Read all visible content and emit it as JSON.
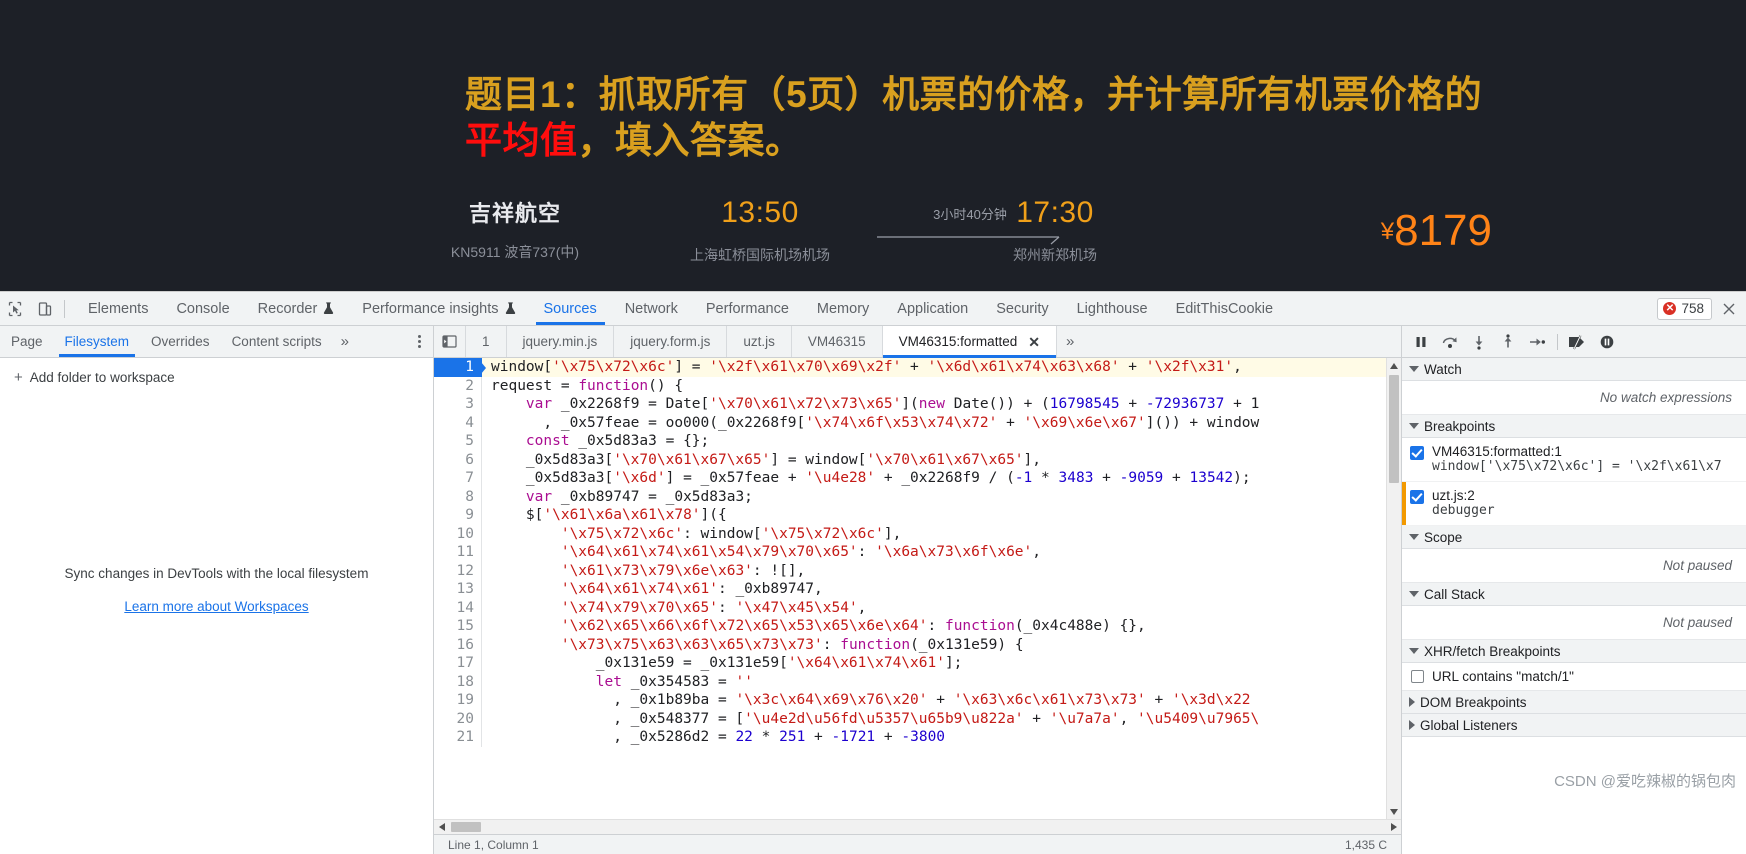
{
  "page": {
    "headline_part1": "题目1：抓取所有（5页）机票的价格，并计算所有机票价格的",
    "headline_highlight": "平均值",
    "headline_part2": "，填入答案。",
    "flight": {
      "airline": "吉祥航空",
      "aircraft": "KN5911 波音737(中)",
      "depart_time": "13:50",
      "depart_airport": "上海虹桥国际机场机场",
      "duration": "3小时40分钟",
      "arrive_time": "17:30",
      "arrive_airport": "郑州新郑机场",
      "price_currency": "¥",
      "price_amount": "8179"
    }
  },
  "devtools": {
    "inspect_icon": "inspect-cursor-icon",
    "device_icon": "device-toolbar-icon",
    "tabs": [
      {
        "label": "Elements",
        "flask": false,
        "active": false
      },
      {
        "label": "Console",
        "flask": false,
        "active": false
      },
      {
        "label": "Recorder",
        "flask": true,
        "active": false
      },
      {
        "label": "Performance insights",
        "flask": true,
        "active": false
      },
      {
        "label": "Sources",
        "flask": false,
        "active": true
      },
      {
        "label": "Network",
        "flask": false,
        "active": false
      },
      {
        "label": "Performance",
        "flask": false,
        "active": false
      },
      {
        "label": "Memory",
        "flask": false,
        "active": false
      },
      {
        "label": "Application",
        "flask": false,
        "active": false
      },
      {
        "label": "Security",
        "flask": false,
        "active": false
      },
      {
        "label": "Lighthouse",
        "flask": false,
        "active": false
      },
      {
        "label": "EditThisCookie",
        "flask": false,
        "active": false
      }
    ],
    "error_badge": {
      "icon": "error-circle-icon",
      "count": "758"
    },
    "close_icon": "close-devtools-icon",
    "accent_color": "#1a73e8",
    "error_color": "#d93025"
  },
  "navigator": {
    "subtabs": [
      {
        "label": "Page",
        "active": false
      },
      {
        "label": "Filesystem",
        "active": true
      },
      {
        "label": "Overrides",
        "active": false
      },
      {
        "label": "Content scripts",
        "active": false
      }
    ],
    "more_label": "»",
    "add_folder_label": "Add folder to workspace",
    "add_folder_plus": "+",
    "empty_hint": "Sync changes in DevTools with the local filesystem",
    "empty_link": "Learn more about Workspaces"
  },
  "editor": {
    "collapse_icon": "collapse-sidebar-icon",
    "file_tabs": [
      {
        "label": "1",
        "active": false,
        "closable": false
      },
      {
        "label": "jquery.min.js",
        "active": false,
        "closable": false
      },
      {
        "label": "jquery.form.js",
        "active": false,
        "closable": false
      },
      {
        "label": "uzt.js",
        "active": false,
        "closable": false
      },
      {
        "label": "VM46315",
        "active": false,
        "closable": false
      },
      {
        "label": "VM46315:formatted",
        "active": true,
        "closable": true
      }
    ],
    "tab_close_glyph": "✕",
    "more_tabs_label": "»",
    "highlight_line": 1,
    "code_lines": [
      {
        "n": "1",
        "tokens": [
          {
            "t": "window[",
            "c": "pl"
          },
          {
            "t": "'\\x75\\x72\\x6c'",
            "c": "str"
          },
          {
            "t": "] = ",
            "c": "pl"
          },
          {
            "t": "'\\x2f\\x61\\x70\\x69\\x2f'",
            "c": "str"
          },
          {
            "t": " + ",
            "c": "pl"
          },
          {
            "t": "'\\x6d\\x61\\x74\\x63\\x68'",
            "c": "str"
          },
          {
            "t": " + ",
            "c": "pl"
          },
          {
            "t": "'\\x2f\\x31'",
            "c": "str"
          },
          {
            "t": ",",
            "c": "pl"
          }
        ]
      },
      {
        "n": "2",
        "tokens": [
          {
            "t": "request = ",
            "c": "pl"
          },
          {
            "t": "function",
            "c": "kw"
          },
          {
            "t": "() {",
            "c": "pl"
          }
        ]
      },
      {
        "n": "3",
        "tokens": [
          {
            "t": "    ",
            "c": "pl"
          },
          {
            "t": "var",
            "c": "kw"
          },
          {
            "t": " _0x2268f9 = Date[",
            "c": "pl"
          },
          {
            "t": "'\\x70\\x61\\x72\\x73\\x65'",
            "c": "str"
          },
          {
            "t": "](",
            "c": "pl"
          },
          {
            "t": "new",
            "c": "kw"
          },
          {
            "t": " Date()) + (",
            "c": "pl"
          },
          {
            "t": "16798545",
            "c": "num"
          },
          {
            "t": " + ",
            "c": "pl"
          },
          {
            "t": "-72936737",
            "c": "num"
          },
          {
            "t": " + 1",
            "c": "pl"
          }
        ]
      },
      {
        "n": "4",
        "tokens": [
          {
            "t": "      , _0x57feae = oo000(_0x2268f9[",
            "c": "pl"
          },
          {
            "t": "'\\x74\\x6f\\x53\\x74\\x72'",
            "c": "str"
          },
          {
            "t": " + ",
            "c": "pl"
          },
          {
            "t": "'\\x69\\x6e\\x67'",
            "c": "str"
          },
          {
            "t": "]()) + window",
            "c": "pl"
          }
        ]
      },
      {
        "n": "5",
        "tokens": [
          {
            "t": "    ",
            "c": "pl"
          },
          {
            "t": "const",
            "c": "kw"
          },
          {
            "t": " _0x5d83a3 = {};",
            "c": "pl"
          }
        ]
      },
      {
        "n": "6",
        "tokens": [
          {
            "t": "    _0x5d83a3[",
            "c": "pl"
          },
          {
            "t": "'\\x70\\x61\\x67\\x65'",
            "c": "str"
          },
          {
            "t": "] = window[",
            "c": "pl"
          },
          {
            "t": "'\\x70\\x61\\x67\\x65'",
            "c": "str"
          },
          {
            "t": "],",
            "c": "pl"
          }
        ]
      },
      {
        "n": "7",
        "tokens": [
          {
            "t": "    _0x5d83a3[",
            "c": "pl"
          },
          {
            "t": "'\\x6d'",
            "c": "str"
          },
          {
            "t": "] = _0x57feae + ",
            "c": "pl"
          },
          {
            "t": "'\\u4e28'",
            "c": "str"
          },
          {
            "t": " + _0x2268f9 / (",
            "c": "pl"
          },
          {
            "t": "-1",
            "c": "num"
          },
          {
            "t": " * ",
            "c": "pl"
          },
          {
            "t": "3483",
            "c": "num"
          },
          {
            "t": " + ",
            "c": "pl"
          },
          {
            "t": "-9059",
            "c": "num"
          },
          {
            "t": " + ",
            "c": "pl"
          },
          {
            "t": "13542",
            "c": "num"
          },
          {
            "t": ");",
            "c": "pl"
          }
        ]
      },
      {
        "n": "8",
        "tokens": [
          {
            "t": "    ",
            "c": "pl"
          },
          {
            "t": "var",
            "c": "kw"
          },
          {
            "t": " _0xb89747 = _0x5d83a3;",
            "c": "pl"
          }
        ]
      },
      {
        "n": "9",
        "tokens": [
          {
            "t": "    $[",
            "c": "pl"
          },
          {
            "t": "'\\x61\\x6a\\x61\\x78'",
            "c": "str"
          },
          {
            "t": "]({",
            "c": "pl"
          }
        ]
      },
      {
        "n": "10",
        "tokens": [
          {
            "t": "        ",
            "c": "pl"
          },
          {
            "t": "'\\x75\\x72\\x6c'",
            "c": "str"
          },
          {
            "t": ": window[",
            "c": "pl"
          },
          {
            "t": "'\\x75\\x72\\x6c'",
            "c": "str"
          },
          {
            "t": "],",
            "c": "pl"
          }
        ]
      },
      {
        "n": "11",
        "tokens": [
          {
            "t": "        ",
            "c": "pl"
          },
          {
            "t": "'\\x64\\x61\\x74\\x61\\x54\\x79\\x70\\x65'",
            "c": "str"
          },
          {
            "t": ": ",
            "c": "pl"
          },
          {
            "t": "'\\x6a\\x73\\x6f\\x6e'",
            "c": "str"
          },
          {
            "t": ",",
            "c": "pl"
          }
        ]
      },
      {
        "n": "12",
        "tokens": [
          {
            "t": "        ",
            "c": "pl"
          },
          {
            "t": "'\\x61\\x73\\x79\\x6e\\x63'",
            "c": "str"
          },
          {
            "t": ": ![],",
            "c": "pl"
          }
        ]
      },
      {
        "n": "13",
        "tokens": [
          {
            "t": "        ",
            "c": "pl"
          },
          {
            "t": "'\\x64\\x61\\x74\\x61'",
            "c": "str"
          },
          {
            "t": ": _0xb89747,",
            "c": "pl"
          }
        ]
      },
      {
        "n": "14",
        "tokens": [
          {
            "t": "        ",
            "c": "pl"
          },
          {
            "t": "'\\x74\\x79\\x70\\x65'",
            "c": "str"
          },
          {
            "t": ": ",
            "c": "pl"
          },
          {
            "t": "'\\x47\\x45\\x54'",
            "c": "str"
          },
          {
            "t": ",",
            "c": "pl"
          }
        ]
      },
      {
        "n": "15",
        "tokens": [
          {
            "t": "        ",
            "c": "pl"
          },
          {
            "t": "'\\x62\\x65\\x66\\x6f\\x72\\x65\\x53\\x65\\x6e\\x64'",
            "c": "str"
          },
          {
            "t": ": ",
            "c": "pl"
          },
          {
            "t": "function",
            "c": "kw"
          },
          {
            "t": "(_0x4c488e) {},",
            "c": "pl"
          }
        ]
      },
      {
        "n": "16",
        "tokens": [
          {
            "t": "        ",
            "c": "pl"
          },
          {
            "t": "'\\x73\\x75\\x63\\x63\\x65\\x73\\x73'",
            "c": "str"
          },
          {
            "t": ": ",
            "c": "pl"
          },
          {
            "t": "function",
            "c": "kw"
          },
          {
            "t": "(_0x131e59) {",
            "c": "pl"
          }
        ]
      },
      {
        "n": "17",
        "tokens": [
          {
            "t": "            _0x131e59 = _0x131e59[",
            "c": "pl"
          },
          {
            "t": "'\\x64\\x61\\x74\\x61'",
            "c": "str"
          },
          {
            "t": "];",
            "c": "pl"
          }
        ]
      },
      {
        "n": "18",
        "tokens": [
          {
            "t": "            ",
            "c": "pl"
          },
          {
            "t": "let",
            "c": "kw"
          },
          {
            "t": " _0x354583 = ",
            "c": "pl"
          },
          {
            "t": "''",
            "c": "str"
          }
        ]
      },
      {
        "n": "19",
        "tokens": [
          {
            "t": "              , _0x1b89ba = ",
            "c": "pl"
          },
          {
            "t": "'\\x3c\\x64\\x69\\x76\\x20'",
            "c": "str"
          },
          {
            "t": " + ",
            "c": "pl"
          },
          {
            "t": "'\\x63\\x6c\\x61\\x73\\x73'",
            "c": "str"
          },
          {
            "t": " + ",
            "c": "pl"
          },
          {
            "t": "'\\x3d\\x22",
            "c": "str"
          }
        ]
      },
      {
        "n": "20",
        "tokens": [
          {
            "t": "              , _0x548377 = [",
            "c": "pl"
          },
          {
            "t": "'\\u4e2d\\u56fd\\u5357\\u65b9\\u822a'",
            "c": "str"
          },
          {
            "t": " + ",
            "c": "pl"
          },
          {
            "t": "'\\u7a7a'",
            "c": "str"
          },
          {
            "t": ", ",
            "c": "pl"
          },
          {
            "t": "'\\u5409\\u7965\\",
            "c": "str"
          }
        ]
      },
      {
        "n": "21",
        "tokens": [
          {
            "t": "              , _0x5286d2 = ",
            "c": "pl"
          },
          {
            "t": "22",
            "c": "num"
          },
          {
            "t": " * ",
            "c": "pl"
          },
          {
            "t": "251",
            "c": "num"
          },
          {
            "t": " + ",
            "c": "pl"
          },
          {
            "t": "-1721",
            "c": "num"
          },
          {
            "t": " + ",
            "c": "pl"
          },
          {
            "t": "-3800",
            "c": "num"
          }
        ]
      }
    ],
    "status_left": "Line 1, Column 1",
    "status_right": "1,435 C"
  },
  "debugger": {
    "toolbar": [
      {
        "icon": "pause-resume-icon",
        "name": "pause-script-button"
      },
      {
        "icon": "step-over-icon",
        "name": "step-over-button"
      },
      {
        "icon": "step-into-icon",
        "name": "step-into-button"
      },
      {
        "icon": "step-out-icon",
        "name": "step-out-button"
      },
      {
        "icon": "step-icon",
        "name": "step-button"
      },
      {
        "icon": "deactivate-breakpoints-icon",
        "name": "deactivate-breakpoints-button"
      },
      {
        "icon": "pause-on-exceptions-icon",
        "name": "pause-on-exceptions-button"
      }
    ],
    "sections": {
      "watch": {
        "title": "Watch",
        "empty": "No watch expressions",
        "expanded": true
      },
      "breakpoints": {
        "title": "Breakpoints",
        "expanded": true,
        "items": [
          {
            "checked": true,
            "marked": false,
            "title": "VM46315:formatted:1",
            "code": "window['\\x75\\x72\\x6c'] = '\\x2f\\x61\\x7"
          },
          {
            "checked": true,
            "marked": true,
            "title": "uzt.js:2",
            "code": "debugger"
          }
        ]
      },
      "scope": {
        "title": "Scope",
        "empty": "Not paused",
        "expanded": true
      },
      "callstack": {
        "title": "Call Stack",
        "empty": "Not paused",
        "expanded": true
      },
      "xhr": {
        "title": "XHR/fetch Breakpoints",
        "expanded": true,
        "items": [
          {
            "checked": false,
            "label": "URL contains \"match/1\""
          }
        ]
      },
      "dom": {
        "title": "DOM Breakpoints",
        "expanded": false
      },
      "global": {
        "title": "Global Listeners",
        "expanded": false
      }
    }
  },
  "watermark": "CSDN @爱吃辣椒的锅包肉"
}
